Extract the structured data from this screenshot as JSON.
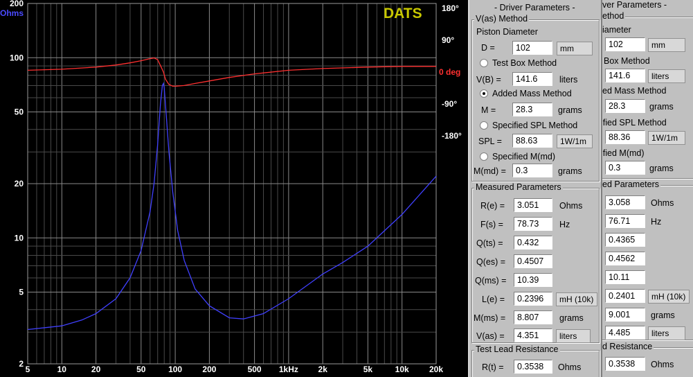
{
  "plot": {
    "brand": "DATS",
    "brand_color": "#c8c800",
    "impedance_color": "#4040ff",
    "phase_color": "#ff3030",
    "unit_left": "Ohms",
    "unit_right": "0 deg",
    "left_ticks": [
      "200",
      "100",
      "50",
      "20",
      "10",
      "5",
      "2"
    ],
    "right_ticks": [
      "180°",
      "90°",
      "-90°",
      "-180°"
    ],
    "x_ticks": [
      "5",
      "10",
      "20",
      "50",
      "100",
      "200",
      "500",
      "1kHz",
      "2k",
      "5k",
      "10k",
      "20k"
    ]
  },
  "chart_data": {
    "type": "line",
    "x_scale": "log",
    "xlim": [
      5,
      20000
    ],
    "y_left_scale": "log",
    "y_left_lim": [
      2,
      200
    ],
    "y_right_lim": [
      -180,
      180
    ],
    "series": [
      {
        "axis": "left",
        "x": [
          5,
          10,
          15,
          20,
          30,
          40,
          50,
          60,
          65,
          70,
          74,
          77,
          78.73,
          80,
          83,
          88,
          95,
          105,
          120,
          150,
          200,
          300,
          400,
          600,
          1000,
          2000,
          3000,
          5000,
          10000,
          20000
        ],
        "y": [
          3.1,
          3.25,
          3.5,
          3.8,
          4.6,
          6.0,
          8.5,
          14,
          20,
          33,
          55,
          70,
          72,
          68,
          50,
          30,
          18,
          11,
          7.5,
          5.2,
          4.2,
          3.6,
          3.55,
          3.8,
          4.6,
          6.3,
          7.3,
          9,
          13.5,
          22
        ]
      },
      {
        "axis": "right",
        "x": [
          5,
          10,
          20,
          30,
          40,
          50,
          60,
          65,
          70,
          75,
          78.73,
          82,
          88,
          95,
          100,
          120,
          150,
          200,
          300,
          500,
          1000,
          2000,
          5000,
          10000,
          20000
        ],
        "y": [
          5,
          8,
          14,
          20,
          26,
          32,
          38,
          40,
          35,
          15,
          0,
          -20,
          -35,
          -40,
          -40,
          -38,
          -32,
          -25,
          -15,
          -5,
          5,
          10,
          14,
          16,
          16
        ]
      }
    ]
  },
  "a": {
    "title": "- Driver Parameters -",
    "vas_group": "V(as) Method",
    "piston_label": "Piston Diameter",
    "d_label": "D =",
    "d_value": "102",
    "d_unit": "mm",
    "testbox_label": "Test Box Method",
    "vb_label": "V(B) =",
    "vb_value": "141.6",
    "vb_unit": "liters",
    "addedmass_label": "Added Mass Method",
    "m_label": "M =",
    "m_value": "28.3",
    "m_unit": "grams",
    "spl_method_label": "Specified SPL Method",
    "spl_label": "SPL =",
    "spl_value": "88.63",
    "spl_unit": "1W/1m",
    "mmd_method_label": "Specified M(md)",
    "mmd_label": "M(md) =",
    "mmd_value": "0.3",
    "mmd_unit": "grams",
    "measured_group": "Measured Parameters",
    "re_label": "R(e) =",
    "re_value": "3.051",
    "re_unit": "Ohms",
    "fs_label": "F(s) =",
    "fs_value": "78.73",
    "fs_unit": "Hz",
    "qts_label": "Q(ts) =",
    "qts_value": "0.432",
    "qes_label": "Q(es) =",
    "qes_value": "0.4507",
    "qms_label": "Q(ms) =",
    "qms_value": "10.39",
    "le_label": "L(e) =",
    "le_value": "0.2396",
    "le_unit": "mH (10k)",
    "mms_label": "M(ms) =",
    "mms_value": "8.807",
    "mms_unit": "grams",
    "vas_label": "V(as) =",
    "vas_value": "4.351",
    "vas_unit": "liters",
    "lead_group": "Test Lead Resistance",
    "rt_label": "R(t) =",
    "rt_value": "0.3538",
    "rt_unit": "Ohms"
  },
  "b": {
    "title": "ver Parameters -",
    "vas_group": "ethod",
    "piston_label": "iameter",
    "d_value": "102",
    "d_unit": "mm",
    "testbox_label": "Box Method",
    "vb_value": "141.6",
    "vb_unit": "liters",
    "addedmass_label": "ed Mass Method",
    "m_value": "28.3",
    "m_unit": "grams",
    "spl_method_label": "ified SPL Method",
    "spl_value": "88.36",
    "spl_unit": "1W/1m",
    "mmd_method_label": "ified M(md)",
    "mmd_value": "0.3",
    "mmd_unit": "grams",
    "measured_group": "ed Parameters",
    "re_value": "3.058",
    "re_unit": "Ohms",
    "fs_value": "76.71",
    "fs_unit": "Hz",
    "qts_value": "0.4365",
    "qes_value": "0.4562",
    "qms_value": "10.11",
    "le_value": "0.2401",
    "le_unit": "mH (10k)",
    "mms_value": "9.001",
    "mms_unit": "grams",
    "vas_value": "4.485",
    "vas_unit": "liters",
    "lead_group": "d Resistance",
    "rt_value": "0.3538",
    "rt_unit": "Ohms"
  }
}
